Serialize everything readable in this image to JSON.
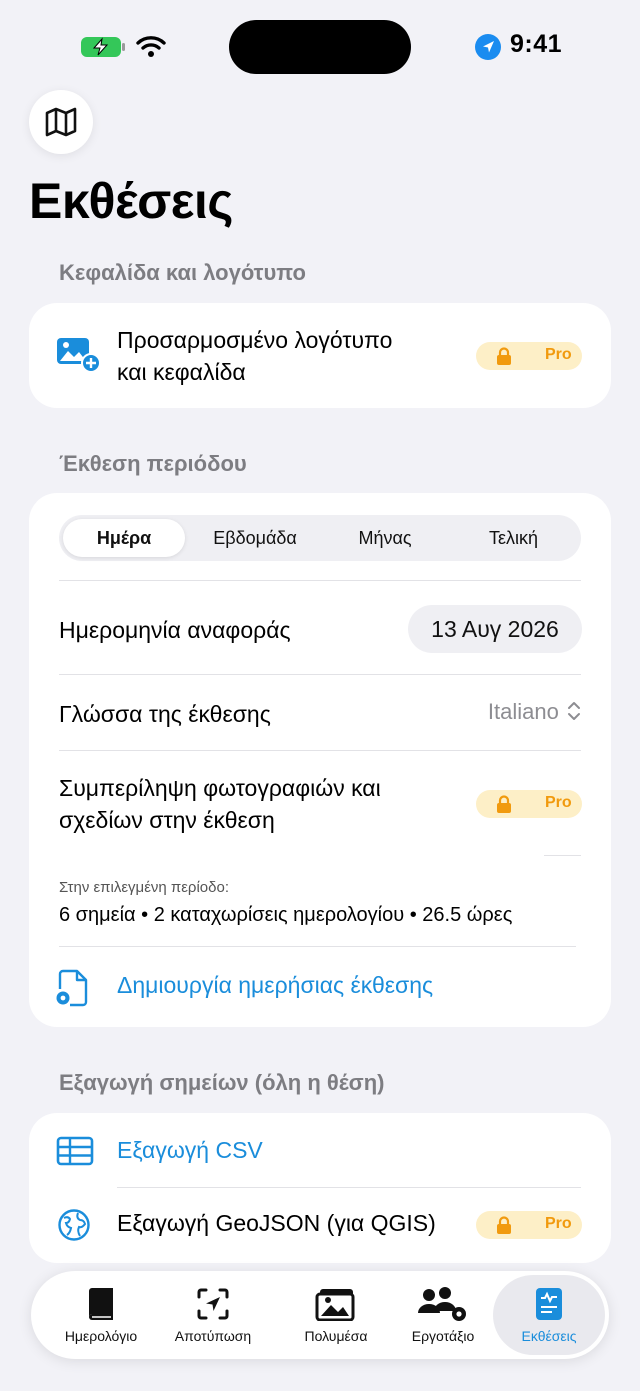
{
  "status_bar": {
    "time": "9:41"
  },
  "page": {
    "title": "Εκθέσεις"
  },
  "header_section": {
    "title": "Κεφαλίδα και λογότυπο",
    "row_label_line1": "Προσαρμοσμένο λογότυπο",
    "row_label_line2": "και κεφαλίδα",
    "badge": "Pro"
  },
  "period_section": {
    "title": "Έκθεση περιόδου",
    "segments": [
      "Ημέρα",
      "Εβδομάδα",
      "Μήνας",
      "Τελική"
    ],
    "selected_segment": "Ημέρα",
    "report_date_label": "Ημερομηνία αναφοράς",
    "report_date_value": "13 Αυγ 2026",
    "language_label": "Γλώσσα της έκθεσης",
    "language_value": "Italiano",
    "include_photos_line1": "Συμπερίληψη φωτογραφιών και",
    "include_photos_line2": "σχεδίων στην έκθεση",
    "include_badge": "Pro",
    "stats_caption": "Στην επιλεγμένη περίοδο:",
    "stats_text": "6 σημεία • 2 καταχωρίσεις ημερολογίου • 26.5 ώρες",
    "create_report": "Δημιουργία ημερήσιας έκθεσης"
  },
  "export_section": {
    "title": "Εξαγωγή σημείων (όλη η θέση)",
    "csv_label": "Εξαγωγή CSV",
    "geojson_label": "Εξαγωγή GeoJSON (για QGIS)",
    "geojson_badge": "Pro"
  },
  "tabbar": {
    "items": [
      {
        "label": "Ημερολόγιο",
        "icon": "book-icon"
      },
      {
        "label": "Αποτύπωση",
        "icon": "location-scan-icon"
      },
      {
        "label": "Πολυμέσα",
        "icon": "photo-stack-icon"
      },
      {
        "label": "Εργοτάξιο",
        "icon": "people-gear-icon"
      },
      {
        "label": "Εκθέσεις",
        "icon": "report-icon"
      }
    ],
    "active": "Εκθέσεις"
  },
  "colors": {
    "accent": "#1a8ddb",
    "pro_badge_bg": "#fdefc7",
    "pro_badge_fg": "#f19a0e",
    "background": "#f2f2f7"
  }
}
